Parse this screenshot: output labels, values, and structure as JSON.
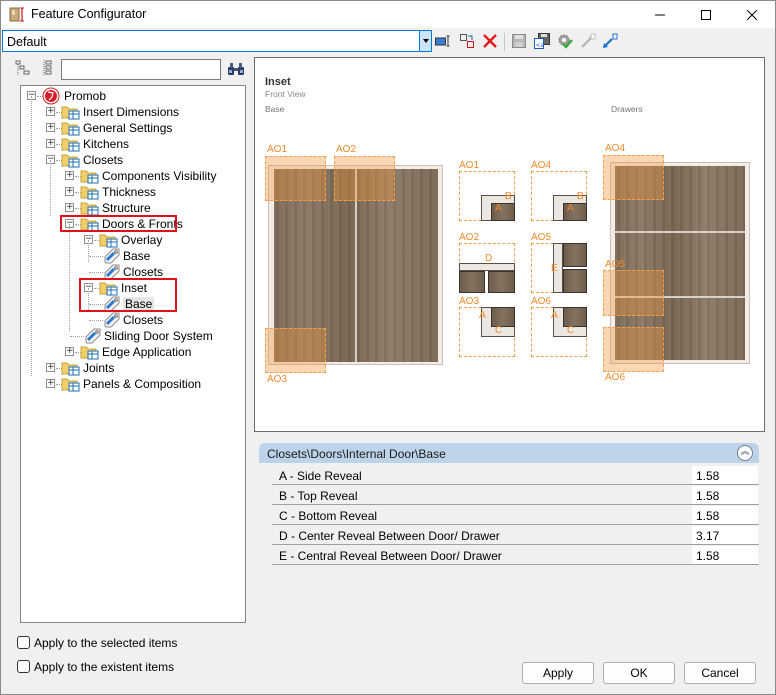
{
  "window": {
    "title": "Feature Configurator",
    "controls": {
      "minimize": "minimize",
      "maximize": "maximize",
      "close": "close"
    }
  },
  "toolbar": {
    "profile_value": "Default",
    "icons": [
      "rename-icon",
      "copy-profile-icon",
      "delete-icon",
      "save-icon",
      "save-as-icon",
      "settings-check-icon",
      "export-icon",
      "import-icon"
    ]
  },
  "tree_toolbar": {
    "search_value": "",
    "search_placeholder": ""
  },
  "tree": {
    "items": [
      {
        "label": "Promob",
        "level": 0,
        "type": "root",
        "expanded": true
      },
      {
        "label": "Insert Dimensions",
        "level": 1,
        "type": "folder",
        "expanded": false
      },
      {
        "label": "General Settings",
        "level": 1,
        "type": "folder",
        "expanded": false
      },
      {
        "label": "Kitchens",
        "level": 1,
        "type": "folder",
        "expanded": false
      },
      {
        "label": "Closets",
        "level": 1,
        "type": "folder",
        "expanded": true
      },
      {
        "label": "Components Visibility",
        "level": 2,
        "type": "folder",
        "expanded": false
      },
      {
        "label": "Thickness",
        "level": 2,
        "type": "folder",
        "expanded": false
      },
      {
        "label": "Structure",
        "level": 2,
        "type": "folder",
        "expanded": false
      },
      {
        "label": "Doors & Fronts",
        "level": 2,
        "type": "folder",
        "expanded": true,
        "highlighted": true
      },
      {
        "label": "Overlay",
        "level": 3,
        "type": "folder",
        "expanded": true
      },
      {
        "label": "Base",
        "level": 4,
        "type": "tag"
      },
      {
        "label": "Closets",
        "level": 4,
        "type": "tag"
      },
      {
        "label": "Inset",
        "level": 3,
        "type": "folder",
        "expanded": true,
        "highlighted": true
      },
      {
        "label": "Base",
        "level": 4,
        "type": "tag",
        "selected": true,
        "highlighted": true
      },
      {
        "label": "Closets",
        "level": 4,
        "type": "tag"
      },
      {
        "label": "Sliding Door System",
        "level": 3,
        "type": "tag"
      },
      {
        "label": "Edge Application",
        "level": 2,
        "type": "folder",
        "expanded": false
      },
      {
        "label": "Joints",
        "level": 1,
        "type": "folder",
        "expanded": false
      },
      {
        "label": "Panels & Composition",
        "level": 1,
        "type": "folder",
        "expanded": false
      }
    ]
  },
  "preview": {
    "title": "Inset",
    "subtitle": "Front View",
    "left_section": "Base",
    "right_section": "Drawers",
    "base_annotations": [
      "AO1",
      "AO2",
      "AO3"
    ],
    "drawer_annotations": [
      "AO4",
      "AO5",
      "AO6"
    ],
    "details": [
      {
        "label": "AO1",
        "letters": [
          "B",
          "A"
        ]
      },
      {
        "label": "AO4",
        "letters": [
          "B",
          "A"
        ]
      },
      {
        "label": "AO2",
        "letters": [
          "D"
        ]
      },
      {
        "label": "AO5",
        "letters": [
          "E"
        ]
      },
      {
        "label": "AO3",
        "letters": [
          "A",
          "C"
        ]
      },
      {
        "label": "AO6",
        "letters": [
          "A",
          "C"
        ]
      }
    ]
  },
  "properties": {
    "header": "Closets\\Doors\\Internal Door\\Base",
    "rows": [
      {
        "name": "A - Side Reveal",
        "value": "1.58"
      },
      {
        "name": "B - Top Reveal",
        "value": "1.58"
      },
      {
        "name": "C - Bottom Reveal",
        "value": "1.58"
      },
      {
        "name": "D - Center Reveal Between Door/ Drawer",
        "value": "3.17"
      },
      {
        "name": "E - Central Reveal Between Door/ Drawer",
        "value": "1.58"
      }
    ]
  },
  "options": {
    "apply_selected": {
      "label": "Apply to the selected items",
      "checked": false
    },
    "apply_existent": {
      "label": "Apply to the existent items",
      "checked": false
    }
  },
  "buttons": {
    "apply": "Apply",
    "ok": "OK",
    "cancel": "Cancel"
  },
  "colors": {
    "highlight_box": "#e0111a",
    "annotation": "#f0a050",
    "header_blue": "#bcd3ea",
    "focus_blue": "#0078d7"
  }
}
